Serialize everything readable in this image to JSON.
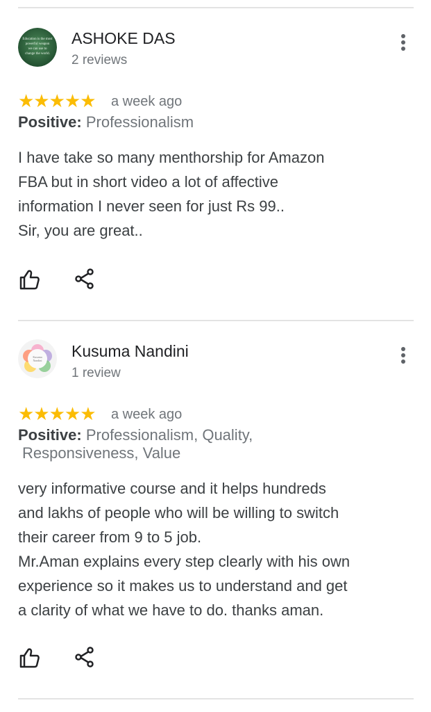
{
  "reviews": [
    {
      "name": "ASHOKE DAS",
      "count": "2 reviews",
      "avatar_quote": "Education is the most powerful weapon we can use to change the world.",
      "rating": "★★★★★",
      "date": "a week ago",
      "attr_label": "Positive:",
      "attr_lines": [
        "Professionalism"
      ],
      "text_lines": [
        "I have take so many menthorship for Amazon",
        "FBA but in short video a lot of affective",
        "information I never seen for just Rs 99..",
        "Sir, you are great.."
      ]
    },
    {
      "name": "Kusuma Nandini",
      "count": "1 review",
      "rating": "★★★★★",
      "date": "a week ago",
      "attr_label": "Positive:",
      "attr_lines": [
        "Professionalism, Quality,",
        "Responsiveness, Value"
      ],
      "text_lines": [
        "very informative course and it helps hundreds",
        "and lakhs of people who will be willing to switch",
        "their career from 9 to 5 job.",
        "Mr.Aman explains every step clearly with his own",
        "experience so it makes us to understand and get",
        "a clarity of what we have to do. thanks aman."
      ]
    }
  ],
  "icons": {
    "more": "more-vert-icon",
    "like": "thumb-up-icon",
    "share": "share-icon"
  },
  "colors": {
    "star": "#fbbc04",
    "secondary_text": "#70757a",
    "divider": "#e3e3e3"
  }
}
